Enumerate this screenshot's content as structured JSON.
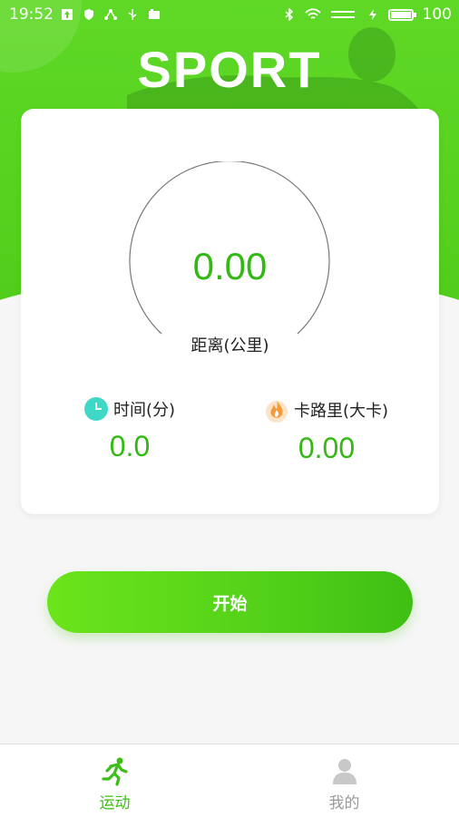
{
  "status_bar": {
    "time": "19:52",
    "battery_level": "100",
    "battery_fraction": 1.0
  },
  "header": {
    "title": "SPORT"
  },
  "card": {
    "distance_value": "0.00",
    "distance_label": "距离(公里)",
    "time_label": "时间(分)",
    "time_value": "0.0",
    "calorie_label": "卡路里(大卡)",
    "calorie_value": "0.00"
  },
  "start_button": {
    "label": "开始"
  },
  "tabbar": {
    "tabs": [
      {
        "label": "运动",
        "icon": "running-icon",
        "active": true
      },
      {
        "label": "我的",
        "icon": "person-icon",
        "active": false
      }
    ]
  },
  "colors": {
    "accent": "#55d31a",
    "value_green": "#34b914",
    "clock_teal": "#3fd8c6",
    "flame_orange": "#f59a3a"
  }
}
